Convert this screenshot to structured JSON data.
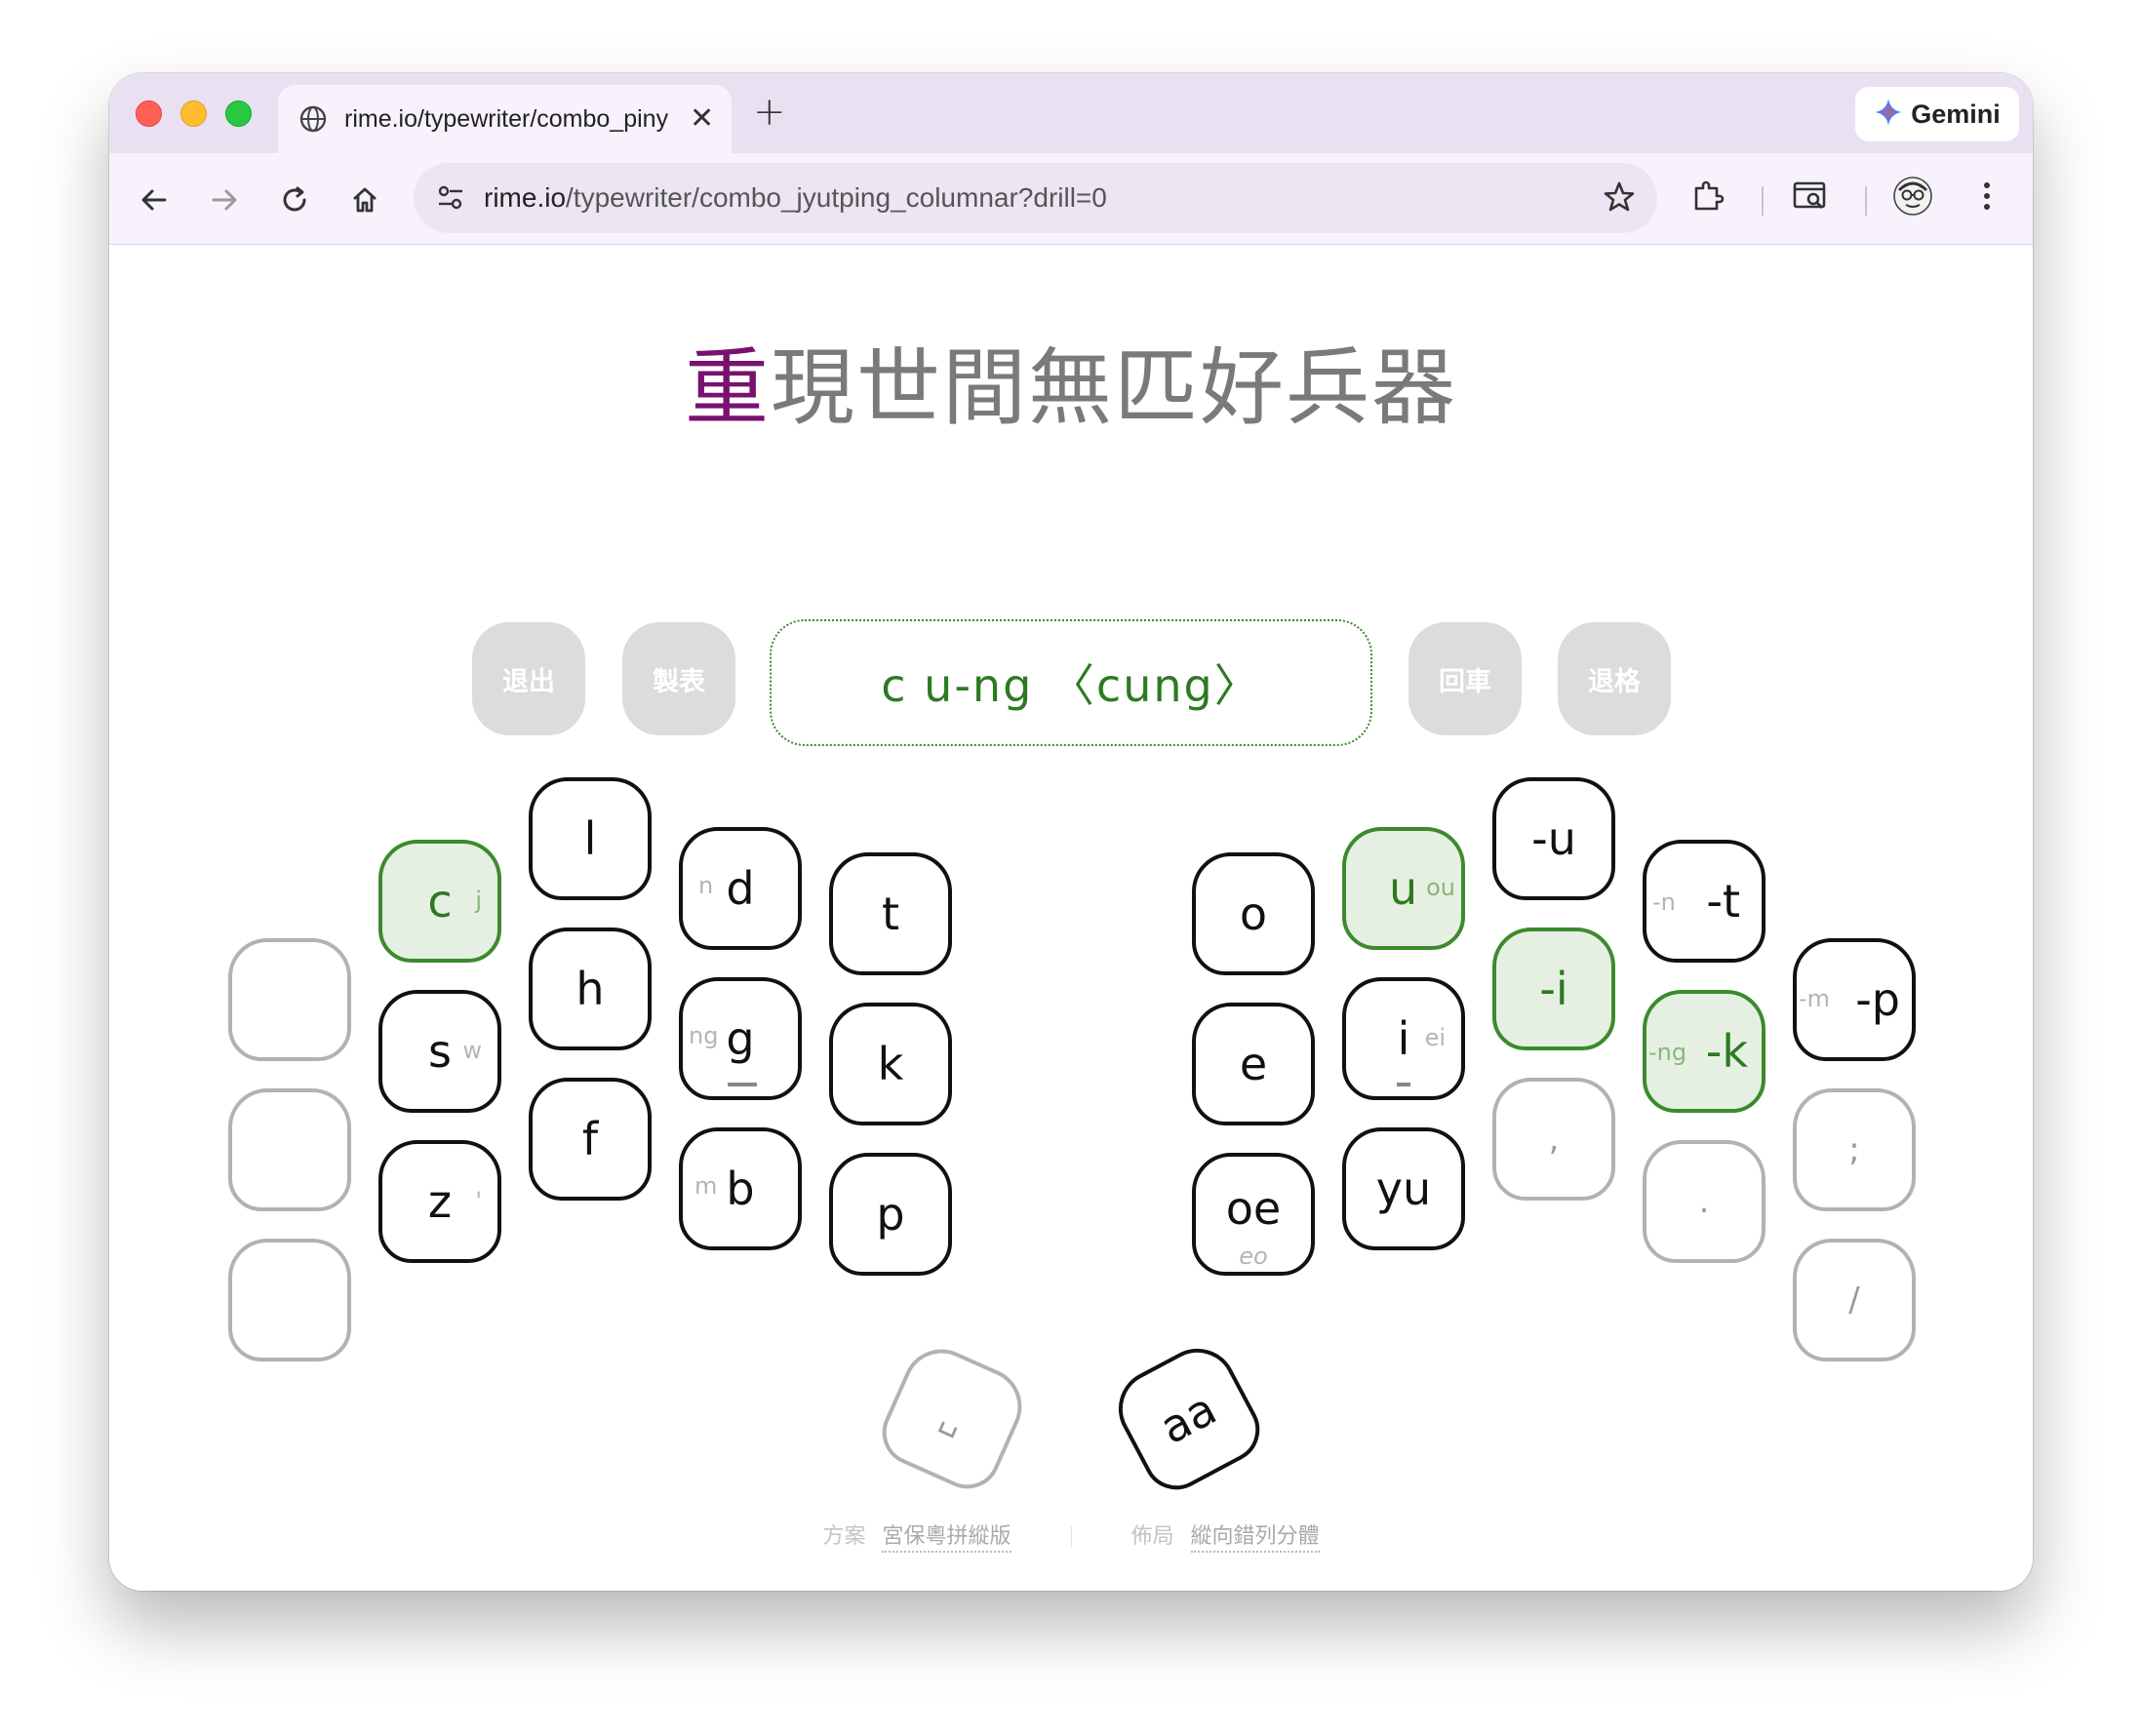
{
  "browser": {
    "tab_title": "rime.io/typewriter/combo_pinyin",
    "new_tab_symbol": "+",
    "close_symbol": "✕",
    "url_host": "rime.io",
    "url_path": "/typewriter/combo_jyutping_columnar?drill=0",
    "gemini_label": "Gemini",
    "accent": "#e9e1f2"
  },
  "page": {
    "headline_active": "重",
    "headline_rest": "現世間無匹好兵器",
    "headline_active_color": "#78126e",
    "accent_green": "#3c8a2e"
  },
  "controls": {
    "exit": "退出",
    "table": "製表",
    "enter": "回車",
    "backspace": "退格"
  },
  "composition": "c u-ng 〈cung〉",
  "keys": {
    "left_shift_1": "",
    "left_shift_2": "",
    "left_shift_3": "",
    "c": "c",
    "c_alt": "j",
    "s": "s",
    "s_alt": "w",
    "z": "z",
    "z_alt": "'",
    "l": "l",
    "h": "h",
    "f": "f",
    "d": "d",
    "d_alt": "n",
    "g": "g",
    "g_alt": "ng",
    "b": "b",
    "b_alt": "m",
    "t": "t",
    "k": "k",
    "p": "p",
    "o": "o",
    "e": "e",
    "oe": "oe",
    "oe_alt": "eo",
    "u": "u",
    "u_alt": "ou",
    "i": "i",
    "i_alt": "ei",
    "yu": "yu",
    "final_u": "-u",
    "final_i": "-i",
    "comma": ",",
    "final_t": "-t",
    "final_t_alt": "-n",
    "final_k": "-k",
    "final_k_alt": "-ng",
    "period": ".",
    "final_p": "-p",
    "final_p_alt": "-m",
    "semicolon": ";",
    "slash": "/",
    "space": "␣",
    "aa": "aa"
  },
  "footer": {
    "scheme_label": "方案",
    "scheme_value": "宮保粵拼縱版",
    "layout_label": "佈局",
    "layout_value": "縱向錯列分體"
  }
}
